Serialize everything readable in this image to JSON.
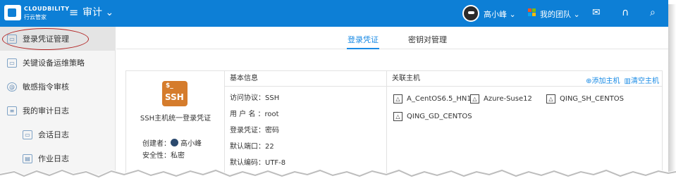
{
  "header": {
    "brand": "CLOUDBILITY",
    "brand_sub": "行云管家",
    "module_label": "审计",
    "user_name": "高小峰",
    "team_label": "我的团队",
    "colors": {
      "bar": "#0d7fd6",
      "accent": "#1a8be5"
    }
  },
  "sidebar": {
    "items": [
      {
        "label": "登录凭证管理",
        "icon": "credential-icon",
        "active": true
      },
      {
        "label": "关键设备运维策略",
        "icon": "device-policy-icon"
      },
      {
        "label": "敏感指令审核",
        "icon": "command-review-icon"
      },
      {
        "label": "我的审计日志",
        "icon": "audit-log-icon"
      },
      {
        "label": "会话日志",
        "icon": "session-log-icon",
        "sub": true
      },
      {
        "label": "作业日志",
        "icon": "job-log-icon",
        "sub": true
      }
    ]
  },
  "tabs": [
    {
      "label": "登录凭证",
      "active": true
    },
    {
      "label": "密钥对管理"
    }
  ],
  "credential": {
    "icon_prompt": "$_",
    "icon_text": "SSH",
    "name": "SSH主机统一登录凭证",
    "creator_label": "创建者：",
    "creator_name": "高小峰",
    "security_label": "安全性：私密"
  },
  "basic_info": {
    "title": "基本信息",
    "rows": [
      "访问协议：SSH",
      "用 户 名 ：root",
      "登录凭证：密码",
      "默认端口：22",
      "默认编码：UTF-8"
    ]
  },
  "hosts": {
    "title": "关联主机",
    "add_label": "⊕添加主机",
    "clear_label": "清空主机",
    "items": [
      "A_CentOS6.5_HN1",
      "Azure-Suse12",
      "QING_SH_CENTOS",
      "QING_GD_CENTOS"
    ]
  }
}
